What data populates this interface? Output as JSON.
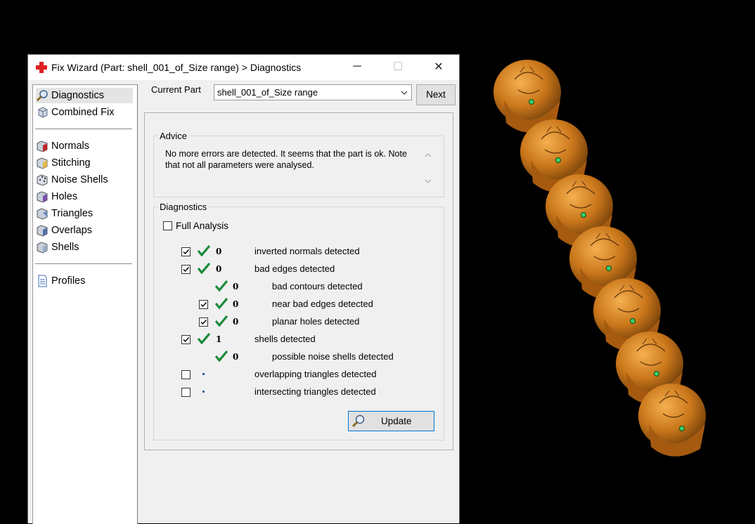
{
  "window": {
    "title": "Fix Wizard (Part: shell_001_of_Size range) > Diagnostics",
    "minimize_glyph": "─",
    "maximize_glyph": "☐",
    "close_glyph": "✕"
  },
  "sidebar": {
    "items": [
      {
        "label": "Diagnostics",
        "icon": "magnifier-icon",
        "selected": true
      },
      {
        "label": "Combined Fix",
        "icon": "cube-icon"
      },
      {
        "label": "Normals",
        "icon": "cube-red-icon"
      },
      {
        "label": "Stitching",
        "icon": "cube-stitch-icon"
      },
      {
        "label": "Noise Shells",
        "icon": "dice-icon"
      },
      {
        "label": "Holes",
        "icon": "cube-hole-icon"
      },
      {
        "label": "Triangles",
        "icon": "cube-triangle-icon"
      },
      {
        "label": "Overlaps",
        "icon": "cube-overlap-icon"
      },
      {
        "label": "Shells",
        "icon": "cube-shells-icon"
      },
      {
        "label": "Profiles",
        "icon": "document-icon"
      }
    ]
  },
  "current_part": {
    "label": "Current Part",
    "value": "shell_001_of_Size range",
    "next_label": "Next"
  },
  "advice": {
    "title": "Advice",
    "text": "No more errors are detected. It seems that the part is ok. Note that not all parameters were analysed."
  },
  "diagnostics": {
    "title": "Diagnostics",
    "full_analysis_label": "Full Analysis",
    "full_analysis_checked": false,
    "rows": [
      {
        "checkbox": true,
        "checked": true,
        "status": "ok",
        "count": "0",
        "label": "inverted normals detected",
        "indent": 0
      },
      {
        "checkbox": true,
        "checked": true,
        "status": "ok",
        "count": "0",
        "label": "bad edges detected",
        "indent": 0
      },
      {
        "checkbox": false,
        "checked": false,
        "status": "ok",
        "count": "0",
        "label": "bad contours detected",
        "indent": 1
      },
      {
        "checkbox": true,
        "checked": true,
        "status": "ok",
        "count": "0",
        "label": "near bad edges detected",
        "indent": 1
      },
      {
        "checkbox": true,
        "checked": true,
        "status": "ok",
        "count": "0",
        "label": "planar holes detected",
        "indent": 1
      },
      {
        "checkbox": true,
        "checked": true,
        "status": "ok",
        "count": "1",
        "label": "shells detected",
        "indent": 0
      },
      {
        "checkbox": false,
        "checked": false,
        "status": "ok",
        "count": "0",
        "label": "possible noise shells detected",
        "indent": 1
      },
      {
        "checkbox": true,
        "checked": false,
        "status": "pending",
        "count": "",
        "label": "overlapping triangles detected",
        "indent": 0
      },
      {
        "checkbox": true,
        "checked": false,
        "status": "pending",
        "count": "",
        "label": "intersecting triangles detected",
        "indent": 0
      }
    ],
    "update_label": "Update"
  },
  "colors": {
    "ring_gold": "#c9761a",
    "check_green": "#1a8a3a",
    "accent_blue": "#0078d7"
  }
}
